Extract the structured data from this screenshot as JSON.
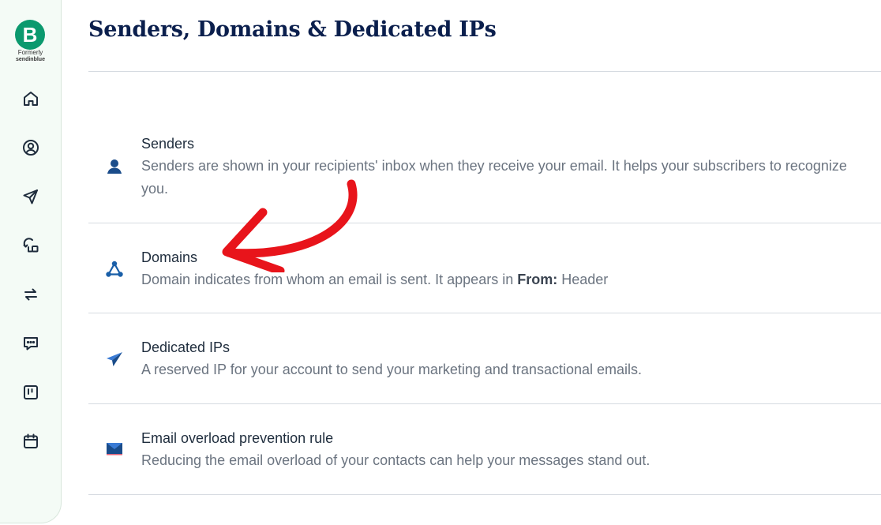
{
  "sidebar": {
    "logo_letter": "B",
    "formerly_label": "Formerly",
    "brand_label": "sendinblue",
    "items": [
      {
        "icon": "home-icon"
      },
      {
        "icon": "contacts-icon"
      },
      {
        "icon": "campaigns-icon"
      },
      {
        "icon": "automations-icon"
      },
      {
        "icon": "transactional-icon"
      },
      {
        "icon": "conversations-icon"
      },
      {
        "icon": "deals-icon"
      },
      {
        "icon": "meetings-icon"
      }
    ]
  },
  "page": {
    "title": "Senders, Domains & Dedicated IPs"
  },
  "sections": [
    {
      "icon": "person-icon",
      "title": "Senders",
      "description": "Senders are shown in your recipients' inbox when they receive your email. It helps your subscribers to recognize you."
    },
    {
      "icon": "domain-network-icon",
      "title": "Domains",
      "description_prefix": "Domain indicates from whom an email is sent. It appears in ",
      "description_bold": "From:",
      "description_suffix": " Header"
    },
    {
      "icon": "paper-plane-icon",
      "title": "Dedicated IPs",
      "description": "A reserved IP for your account to send your marketing and transactional emails."
    },
    {
      "icon": "envelope-icon",
      "title": "Email overload prevention rule",
      "description": "Reducing the email overload of your contacts can help your messages stand out."
    }
  ],
  "colors": {
    "brand": "#0b996e",
    "title": "#0b1f4d",
    "icon_blue": "#1a5fa8",
    "annotation_arrow": "#e8141b"
  }
}
